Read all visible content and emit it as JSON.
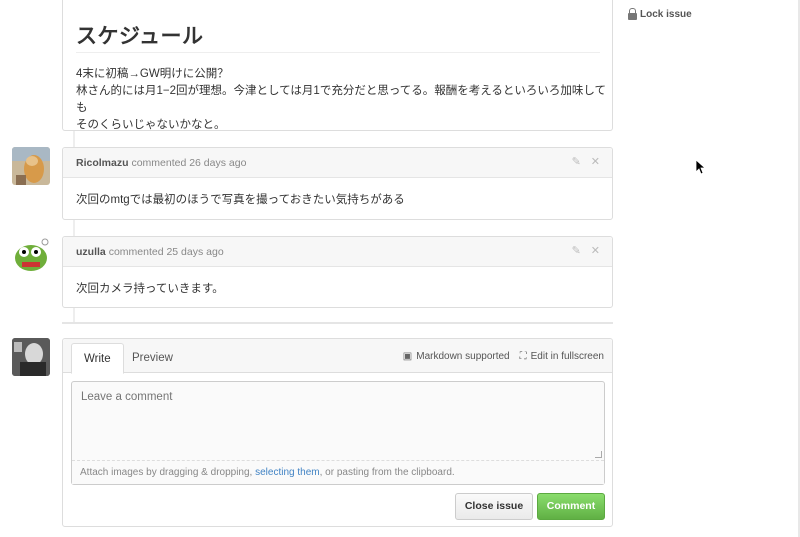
{
  "issue": {
    "heading": "スケジュール",
    "line1": "4末に初稿→GW明けに公開？",
    "line2": "林さん的には月1−2回が理想。今津としては月1で充分だと思ってる。報酬を考えるといろいろ加味しても",
    "line3": "そのくらいじゃないかなと。"
  },
  "comments": [
    {
      "author": "Ricolmazu",
      "meta": "commented 26 days ago",
      "body": "次回のmtgでは最初のほうで写真を撮っておきたい気持ちがある"
    },
    {
      "author": "uzulla",
      "meta": "commented 25 days ago",
      "body": "次回カメラ持っていきます。"
    }
  ],
  "form": {
    "tab_write": "Write",
    "tab_preview": "Preview",
    "markdown_label": "Markdown supported",
    "fullscreen_label": "Edit in fullscreen",
    "placeholder": "Leave a comment",
    "hint_prefix": "Attach images by dragging & dropping, ",
    "hint_link": "selecting them",
    "hint_suffix": ", or pasting from the clipboard.",
    "close_label": "Close issue",
    "comment_label": "Comment"
  },
  "sidebar": {
    "lock_label": "Lock issue"
  },
  "icons": {
    "edit": "pencil-icon",
    "delete": "close-icon",
    "lock": "lock-icon",
    "markdown": "markdown-icon",
    "fullscreen": "fullscreen-icon"
  },
  "colors": {
    "accent_green": "#60b044",
    "link_blue": "#4183c4"
  }
}
